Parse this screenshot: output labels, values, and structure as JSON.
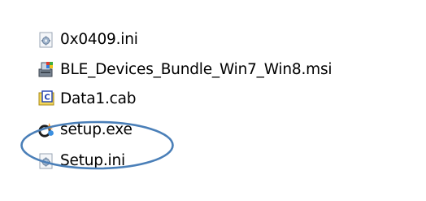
{
  "files": [
    {
      "name": "0x0409.ini",
      "icon": "ini-settings-icon"
    },
    {
      "name": "BLE_Devices_Bundle_Win7_Win8.msi",
      "icon": "msi-installer-icon"
    },
    {
      "name": "Data1.cab",
      "icon": "cab-archive-icon"
    },
    {
      "name": "setup.exe",
      "icon": "setup-exe-icon"
    },
    {
      "name": "Setup.ini",
      "icon": "ini-settings-icon"
    }
  ],
  "highlight": {
    "target": "setup.exe",
    "color": "#4a7fb8"
  }
}
